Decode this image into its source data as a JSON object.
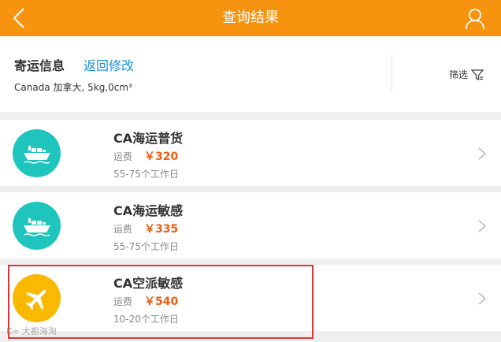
{
  "header": {
    "title": "查询结果",
    "back_icon": "chevron-left-icon",
    "user_icon": "user-icon"
  },
  "shipping_info": {
    "label": "寄运信息",
    "edit_link": "返回修改",
    "details": "Canada 加拿大,   5kg,0cm³",
    "filter_label": "筛选"
  },
  "routes": [
    {
      "icon": "ship-icon",
      "name": "CA海运普货",
      "fee_label": "运费",
      "price": "￥320",
      "days": "55-75个工作日"
    },
    {
      "icon": "ship-icon",
      "name": "CA海运敏感",
      "fee_label": "运费",
      "price": "￥335",
      "days": "55-75个工作日"
    },
    {
      "icon": "airplane-icon",
      "name": "CA空派敏感",
      "fee_label": "运费",
      "price": "￥540",
      "days": "10-20个工作日"
    }
  ],
  "watermark": "K∞ 大都海淘",
  "colors": {
    "header": "#f7930e",
    "link": "#1a8fd8",
    "price": "#ef5d10",
    "sea_icon": "#1ec5bd",
    "air_icon": "#fbb800",
    "highlight": "#d9373b"
  }
}
